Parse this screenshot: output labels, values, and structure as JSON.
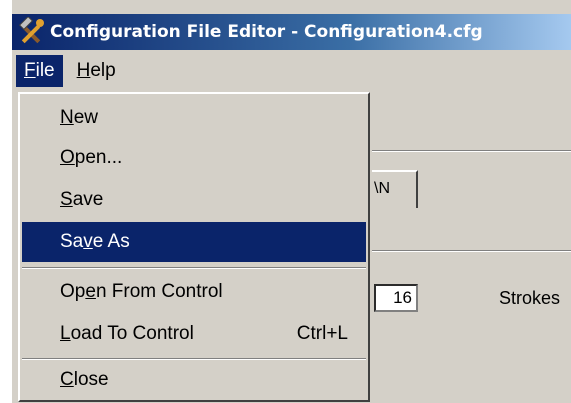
{
  "window": {
    "title": "Configuration File Editor - Configuration4.cfg",
    "title_bar_color": "#0a246a"
  },
  "menubar": {
    "file": {
      "underline": "F",
      "rest": "ile"
    },
    "help": {
      "underline": "H",
      "rest": "elp"
    }
  },
  "file_menu": {
    "highlight_color": "#0a246a",
    "items": [
      {
        "pre": "",
        "u": "N",
        "post": "ew",
        "shortcut": ""
      },
      {
        "pre": "",
        "u": "O",
        "post": "pen...",
        "shortcut": ""
      },
      {
        "pre": "",
        "u": "S",
        "post": "ave",
        "shortcut": ""
      },
      {
        "pre": "Sa",
        "u": "v",
        "post": "e As",
        "shortcut": ""
      },
      {
        "pre": "Op",
        "u": "e",
        "post": "n From Control",
        "shortcut": ""
      },
      {
        "pre": "",
        "u": "L",
        "post": "oad To Control",
        "shortcut": "Ctrl+L"
      },
      {
        "pre": "",
        "u": "C",
        "post": "lose",
        "shortcut": ""
      }
    ]
  },
  "background": {
    "tab_fragment": "\\N",
    "number_field_value": "16",
    "strokes_label": "Strokes"
  }
}
